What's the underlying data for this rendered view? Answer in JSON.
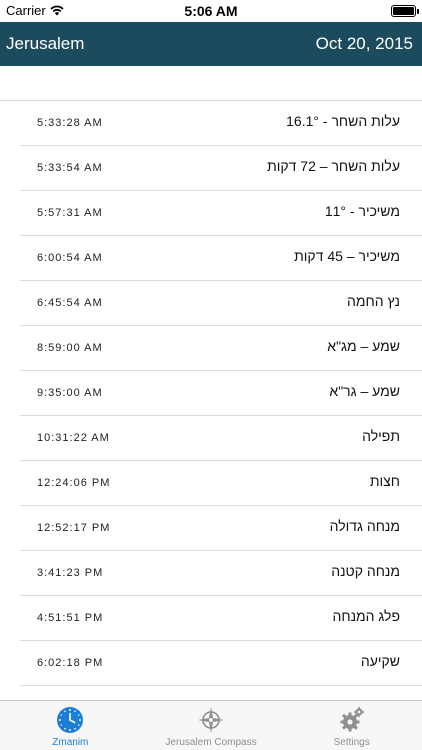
{
  "status_bar": {
    "carrier": "Carrier",
    "time": "5:06 AM"
  },
  "header": {
    "location": "Jerusalem",
    "date": "Oct 20, 2015",
    "background": "#1c4b5d"
  },
  "zmanim": [
    {
      "name": "עלות השחר - 16.1°",
      "time": "5:33:28 AM"
    },
    {
      "name": "עלות השחר – 72 דקות",
      "time": "5:33:54 AM"
    },
    {
      "name": "משיכיר - 11°",
      "time": "5:57:31 AM"
    },
    {
      "name": "משיכיר – 45 דקות",
      "time": "6:00:54 AM"
    },
    {
      "name": "נץ החמה",
      "time": "6:45:54 AM"
    },
    {
      "name": "שמע – מג\"א",
      "time": "8:59:00 AM"
    },
    {
      "name": "שמע – גר\"א",
      "time": "9:35:00 AM"
    },
    {
      "name": "תפילה",
      "time": "10:31:22 AM"
    },
    {
      "name": "חצות",
      "time": "12:24:06 PM"
    },
    {
      "name": "מנחה גדולה",
      "time": "12:52:17 PM"
    },
    {
      "name": "מנחה קטנה",
      "time": "3:41:23 PM"
    },
    {
      "name": "פלג המנחה",
      "time": "4:51:51 PM"
    },
    {
      "name": "שקיעה",
      "time": "6:02:18 PM"
    }
  ],
  "tabs": [
    {
      "label": "Zmanim",
      "icon": "clock-icon",
      "active": true
    },
    {
      "label": "Jerusalem Compass",
      "icon": "compass-icon",
      "active": false
    },
    {
      "label": "Settings",
      "icon": "gear-icon",
      "active": false
    }
  ],
  "colors": {
    "accent": "#1a7fd4",
    "tab_inactive": "#8e8e93"
  }
}
